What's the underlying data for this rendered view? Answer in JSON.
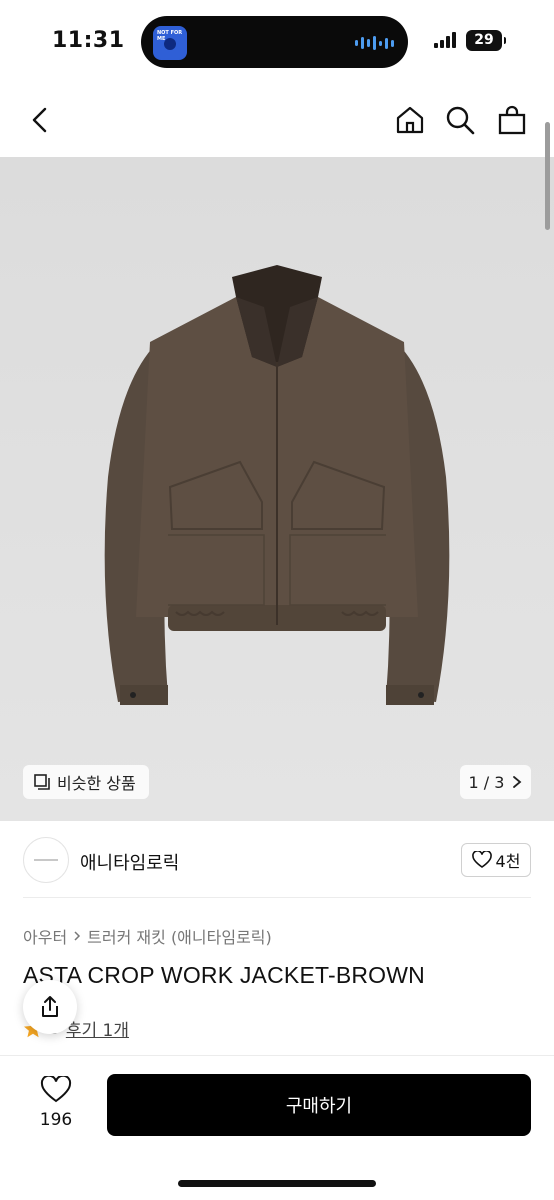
{
  "status_bar": {
    "time": "11:31",
    "battery": "29",
    "island_art_text": "NOT FOR ME"
  },
  "nav": {
    "back_icon": "chevron-left-icon",
    "home_icon": "home-icon",
    "search_icon": "search-icon",
    "bag_icon": "shopping-bag-icon"
  },
  "gallery": {
    "similar_label": "비슷한 상품",
    "page_current": "1",
    "page_total": "3",
    "page_text": "1 / 3",
    "jacket_color": "#5e4f43"
  },
  "seller": {
    "name": "애니타임로릭",
    "likes": "4천"
  },
  "product": {
    "breadcrumb": [
      "아우터",
      "트러커 재킷 (애니타임로릭)"
    ],
    "title": "ASTA CROP WORK JACKET-BROWN",
    "rating": "5",
    "review_link": "후기 1개"
  },
  "bottom_bar": {
    "wish_count": "196",
    "buy_label": "구매하기"
  },
  "colors": {
    "accent": "#000000",
    "star": "#f5a623",
    "island_wave": "#4d9cf0"
  }
}
